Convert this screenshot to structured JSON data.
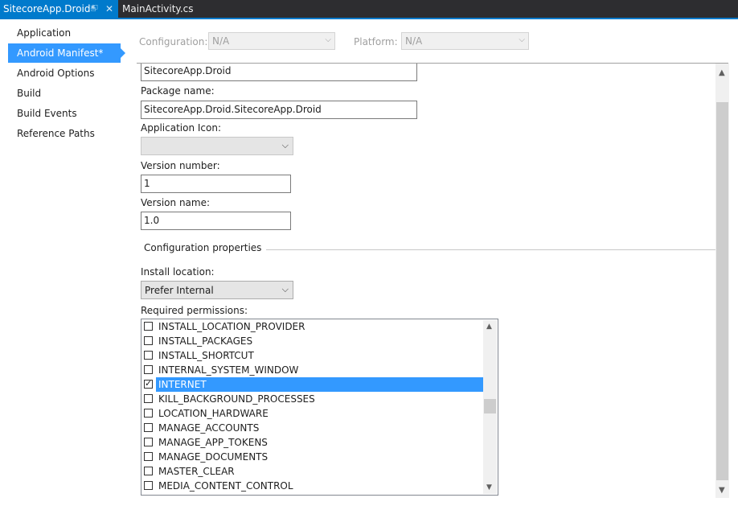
{
  "tabs": [
    {
      "label": "SitecoreApp.Droid*",
      "active": true
    },
    {
      "label": "MainActivity.cs",
      "active": false
    }
  ],
  "nav": {
    "items": [
      {
        "label": "Application"
      },
      {
        "label": "Android Manifest*",
        "selected": true
      },
      {
        "label": "Android Options"
      },
      {
        "label": "Build"
      },
      {
        "label": "Build Events"
      },
      {
        "label": "Reference Paths"
      }
    ]
  },
  "config_bar": {
    "configuration_label": "Configuration:",
    "configuration_value": "N/A",
    "platform_label": "Platform:",
    "platform_value": "N/A"
  },
  "form": {
    "app_name_value": "SitecoreApp.Droid",
    "package_name_label": "Package name:",
    "package_name_value": "SitecoreApp.Droid.SitecoreApp.Droid",
    "app_icon_label": "Application Icon:",
    "app_icon_value": "",
    "version_number_label": "Version number:",
    "version_number_value": "1",
    "version_name_label": "Version name:",
    "version_name_value": "1.0",
    "config_props_title": "Configuration properties",
    "install_location_label": "Install location:",
    "install_location_value": "Prefer Internal",
    "required_permissions_label": "Required permissions:"
  },
  "permissions": [
    {
      "name": "INSTALL_LOCATION_PROVIDER",
      "checked": false
    },
    {
      "name": "INSTALL_PACKAGES",
      "checked": false
    },
    {
      "name": "INSTALL_SHORTCUT",
      "checked": false
    },
    {
      "name": "INTERNAL_SYSTEM_WINDOW",
      "checked": false
    },
    {
      "name": "INTERNET",
      "checked": true,
      "selected": true
    },
    {
      "name": "KILL_BACKGROUND_PROCESSES",
      "checked": false
    },
    {
      "name": "LOCATION_HARDWARE",
      "checked": false
    },
    {
      "name": "MANAGE_ACCOUNTS",
      "checked": false
    },
    {
      "name": "MANAGE_APP_TOKENS",
      "checked": false
    },
    {
      "name": "MANAGE_DOCUMENTS",
      "checked": false
    },
    {
      "name": "MASTER_CLEAR",
      "checked": false
    },
    {
      "name": "MEDIA_CONTENT_CONTROL",
      "checked": false
    }
  ],
  "colors": {
    "accent": "#007acc",
    "selection": "#3399ff",
    "tabbar_bg": "#2d2d30"
  }
}
